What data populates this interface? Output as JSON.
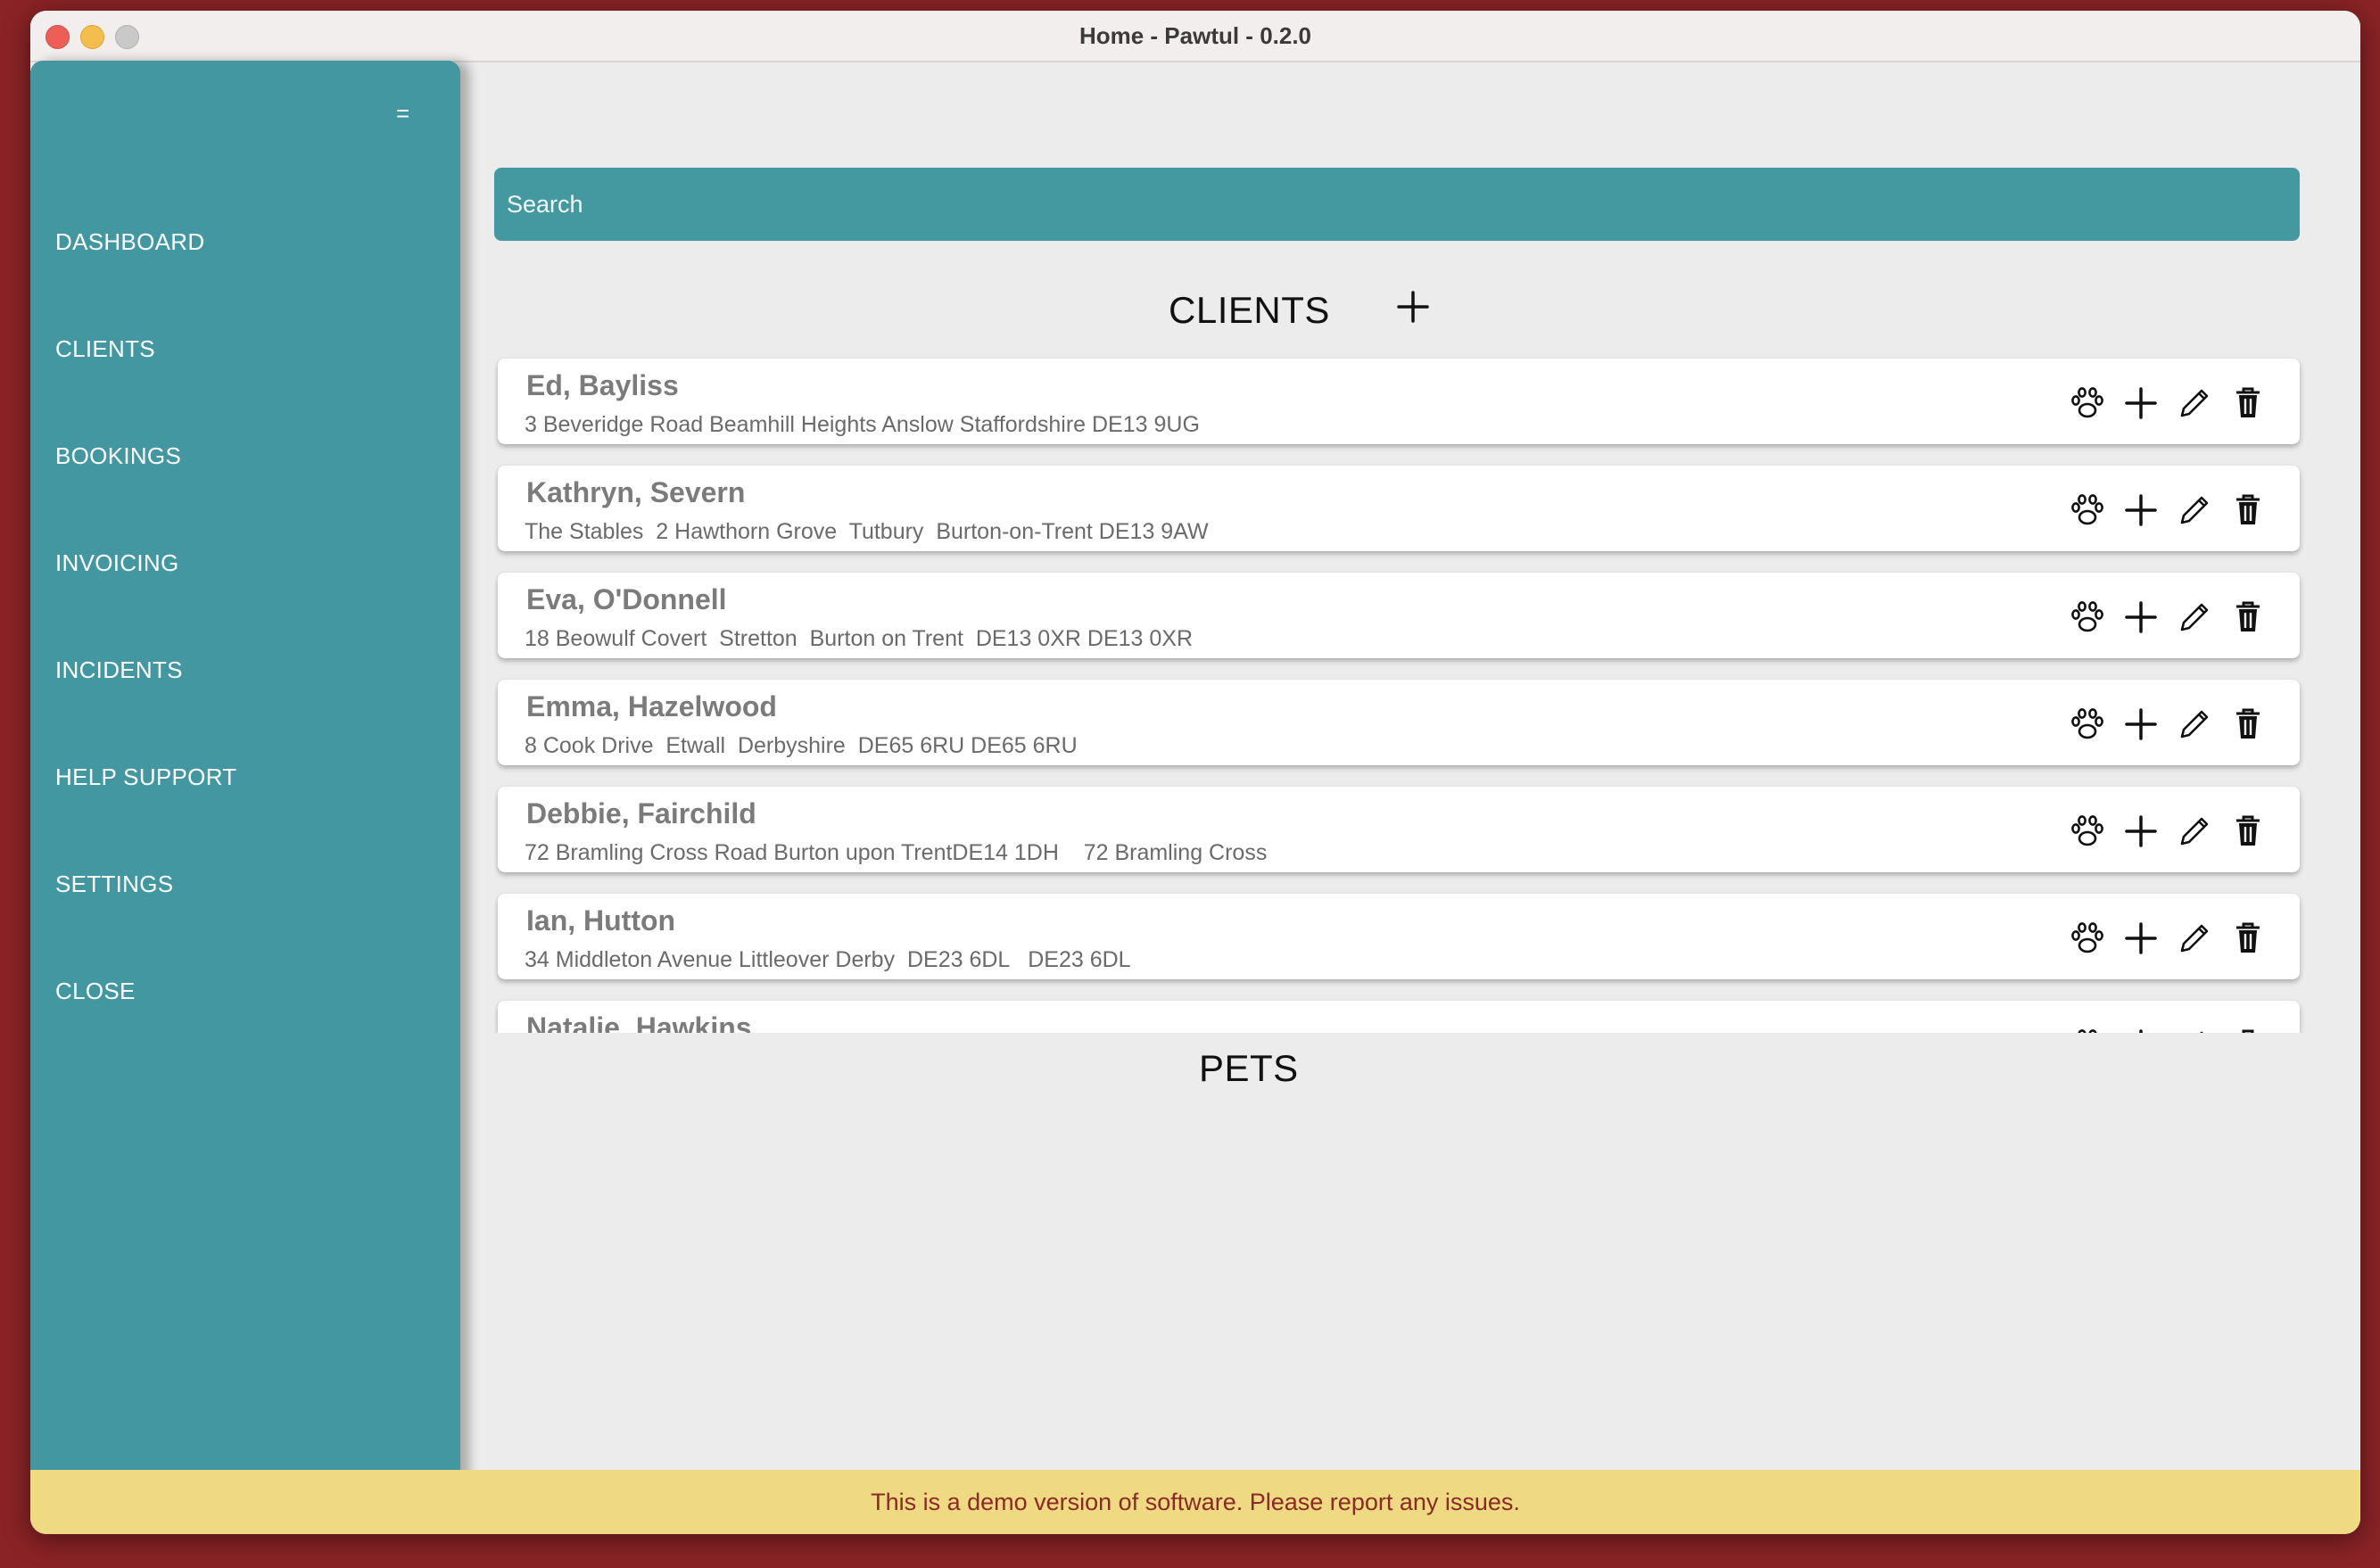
{
  "window": {
    "title": "Home - Pawtul - 0.2.0"
  },
  "sidebar": {
    "menu_glyph": "=",
    "items": [
      {
        "label": "DASHBOARD"
      },
      {
        "label": "CLIENTS"
      },
      {
        "label": "BOOKINGS"
      },
      {
        "label": "INVOICING"
      },
      {
        "label": "INCIDENTS"
      },
      {
        "label": "HELP  SUPPORT"
      },
      {
        "label": "SETTINGS"
      },
      {
        "label": "CLOSE"
      }
    ]
  },
  "search": {
    "placeholder": "Search"
  },
  "clients": {
    "heading": "CLIENTS",
    "add_icon": "plus-icon",
    "row_action_icons": [
      "paw-icon",
      "plus-icon",
      "pencil-icon",
      "trash-icon"
    ],
    "rows": [
      {
        "name": "Ed, Bayliss",
        "address": "3 Beveridge Road Beamhill Heights Anslow Staffordshire DE13 9UG"
      },
      {
        "name": "Kathryn, Severn",
        "address": "The Stables  2 Hawthorn Grove  Tutbury  Burton-on-Trent DE13 9AW"
      },
      {
        "name": "Eva, O'Donnell",
        "address": "18 Beowulf Covert  Stretton  Burton on Trent  DE13 0XR DE13 0XR"
      },
      {
        "name": "Emma, Hazelwood",
        "address": "8 Cook Drive  Etwall  Derbyshire  DE65 6RU DE65 6RU"
      },
      {
        "name": "Debbie, Fairchild",
        "address": "72 Bramling Cross Road Burton upon TrentDE14 1DH    72 Bramling Cross"
      },
      {
        "name": "Ian, Hutton",
        "address": "34 Middleton Avenue Littleover Derby  DE23 6DL   DE23 6DL"
      },
      {
        "name": "Natalie, Hawkins",
        "address": ""
      }
    ]
  },
  "pets": {
    "heading": "PETS"
  },
  "banner": {
    "text": "This is a demo version of software. Please report any issues."
  },
  "colors": {
    "teal": "#4297a0",
    "banner_bg": "#efd982",
    "banner_text": "#8a2a24"
  }
}
